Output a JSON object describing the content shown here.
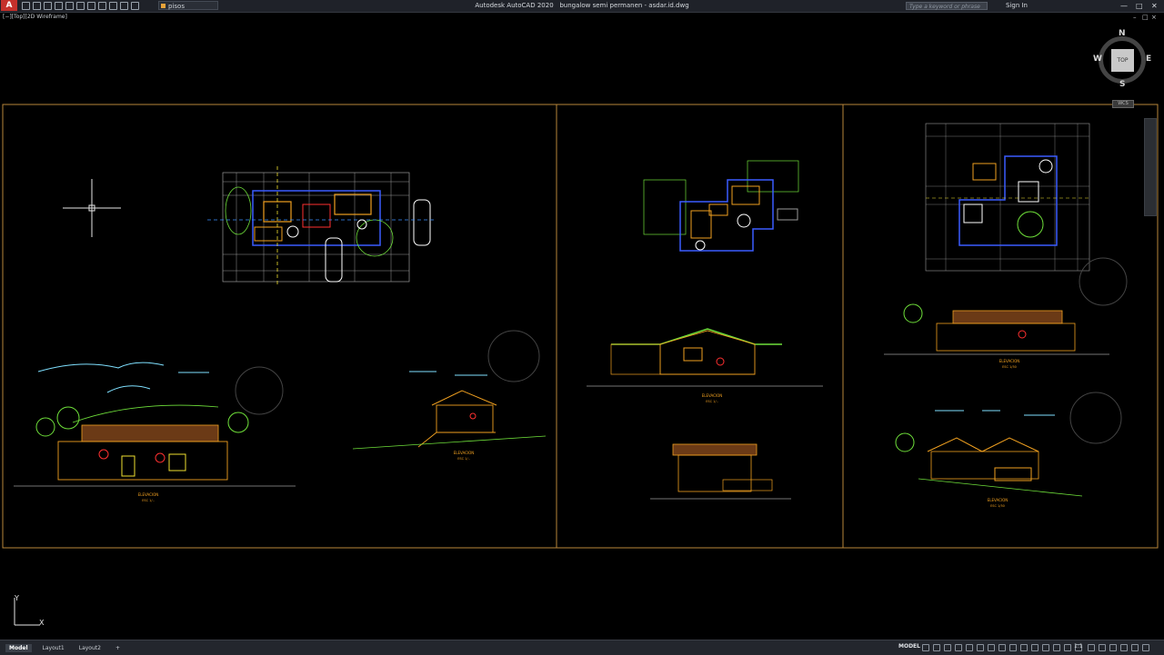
{
  "app": {
    "title": "Autodesk AutoCAD 2020",
    "file": "bungalow semi permanen - asdar.id.dwg",
    "menu_letter": "A"
  },
  "toolbar": {
    "layer_name": "pisos",
    "layer_color": "#e8a33a"
  },
  "search": {
    "placeholder": "Type a keyword or phrase"
  },
  "user": {
    "sign_in": "Sign In"
  },
  "viewport": {
    "label": "[−][Top][2D Wireframe]"
  },
  "viewcube": {
    "face": "TOP",
    "n": "N",
    "s": "S",
    "e": "E",
    "w": "W",
    "wcs": "WCS"
  },
  "ucs": {
    "x": "X",
    "y": "Y"
  },
  "labels": {
    "elev_front_left": "ELEVACION",
    "elev_front_left_scale": "ESC 1/..",
    "elev_side_small": "ELEVACION",
    "elev_side_small_scale": "ESC 1/..",
    "elev_mid": "ELEVACION",
    "elev_mid_scale": "ESC 1/..",
    "elev_right_top": "ELEVACION",
    "elev_right_top_scale": "ESC 1/50",
    "elev_right_bottom": "ELEVACION",
    "elev_right_bottom_scale": "ESC 1/50"
  },
  "tabs": [
    {
      "label": "Model",
      "active": true
    },
    {
      "label": "Layout1",
      "active": false
    },
    {
      "label": "Layout2",
      "active": false
    }
  ],
  "tab_add": "+",
  "status": {
    "model": "MODEL",
    "scale": "1:1"
  },
  "colors": {
    "background": "#000000",
    "frame": "#b8863a",
    "wall": "#f0a020",
    "blue": "#3a5cff",
    "grid": "#9a9a9a",
    "plant": "#6fe03a",
    "sky": "#7fe0ff"
  }
}
